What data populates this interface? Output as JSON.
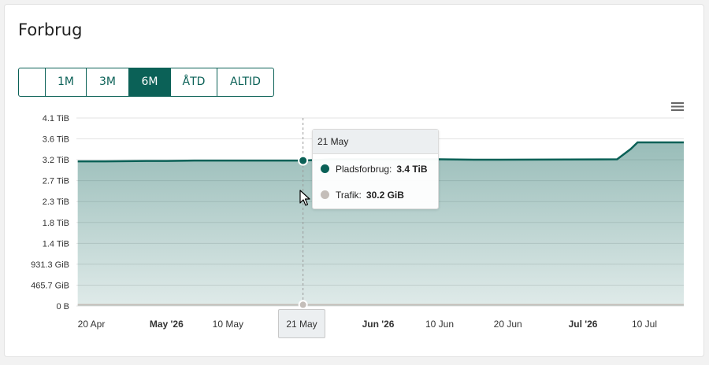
{
  "card": {
    "title": "Forbrug"
  },
  "range_selector": {
    "buttons": [
      {
        "label": ""
      },
      {
        "label": "1M"
      },
      {
        "label": "3M"
      },
      {
        "label": "6M"
      },
      {
        "label": "ÅTD"
      },
      {
        "label": "ALTID"
      }
    ],
    "selected": "6M",
    "accent_color": "#0b6157"
  },
  "chart_menu": {
    "icon": "hamburger-menu-icon"
  },
  "tooltip": {
    "date": "21 May",
    "rows": [
      {
        "label": "Pladsforbrug:",
        "value": "3.4 TiB",
        "color": "#0b6157"
      },
      {
        "label": "Trafik:",
        "value": "30.2 GiB",
        "color": "#c4beb9"
      }
    ]
  },
  "hover_x_label": "21 May",
  "chart_data": {
    "type": "area",
    "y_ticks": [
      "4.1 TiB",
      "3.6 TiB",
      "3.2 TiB",
      "2.7 TiB",
      "2.3 TiB",
      "1.8 TiB",
      "1.4 TiB",
      "931.3 GiB",
      "465.7 GiB",
      "0 B"
    ],
    "ylim_tib": [
      0,
      4.55
    ],
    "x_ticks": [
      {
        "label": "20 Apr",
        "date": "2026-04-20",
        "bold": false
      },
      {
        "label": "May '26",
        "date": "2026-05-01",
        "bold": true
      },
      {
        "label": "10 May",
        "date": "2026-05-10",
        "bold": false
      },
      {
        "label": "Jun '26",
        "date": "2026-06-01",
        "bold": true
      },
      {
        "label": "10 Jun",
        "date": "2026-06-10",
        "bold": false
      },
      {
        "label": "20 Jun",
        "date": "2026-06-20",
        "bold": false
      },
      {
        "label": "Jul '26",
        "date": "2026-07-01",
        "bold": true
      },
      {
        "label": "10 Jul",
        "date": "2026-07-10",
        "bold": false
      }
    ],
    "series": [
      {
        "name": "Pladsforbrug",
        "color": "#0b6157",
        "points": [
          {
            "date": "2026-04-18",
            "tib": 3.5
          },
          {
            "date": "2026-04-22",
            "tib": 3.5
          },
          {
            "date": "2026-04-28",
            "tib": 3.51
          },
          {
            "date": "2026-05-01",
            "tib": 3.51
          },
          {
            "date": "2026-05-05",
            "tib": 3.52
          },
          {
            "date": "2026-05-21",
            "tib": 3.52
          },
          {
            "date": "2026-05-25",
            "tib": 3.55
          },
          {
            "date": "2026-06-10",
            "tib": 3.55
          },
          {
            "date": "2026-06-15",
            "tib": 3.54
          },
          {
            "date": "2026-07-06",
            "tib": 3.55
          },
          {
            "date": "2026-07-08",
            "tib": 3.8
          },
          {
            "date": "2026-07-09",
            "tib": 3.96
          },
          {
            "date": "2026-07-16",
            "tib": 3.96
          }
        ]
      },
      {
        "name": "Trafik",
        "color": "#c4beb9",
        "points": [
          {
            "date": "2026-04-18",
            "tib": 0.03
          },
          {
            "date": "2026-07-16",
            "tib": 0.03
          }
        ]
      }
    ],
    "hover_date": "2026-05-21",
    "grid": true
  }
}
